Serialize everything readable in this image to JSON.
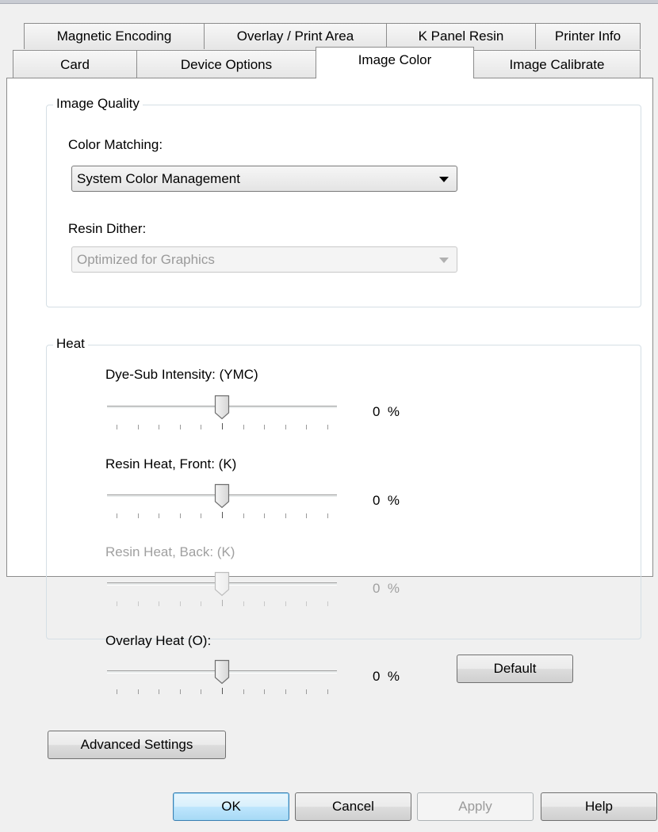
{
  "tabs_row1": [
    {
      "label": "Magnetic Encoding"
    },
    {
      "label": "Overlay / Print Area"
    },
    {
      "label": "K Panel Resin"
    },
    {
      "label": "Printer Info"
    }
  ],
  "tabs_row2": [
    {
      "label": "Card"
    },
    {
      "label": "Device Options"
    },
    {
      "label": "Image Color",
      "active": true
    },
    {
      "label": "Image Calibrate"
    }
  ],
  "image_quality": {
    "title": "Image Quality",
    "color_matching_label": "Color Matching:",
    "color_matching_value": "System Color Management",
    "resin_dither_label": "Resin Dither:",
    "resin_dither_value": "Optimized for Graphics"
  },
  "heat": {
    "title": "Heat",
    "sliders": [
      {
        "label": "Dye-Sub Intensity: (YMC)",
        "value": 0,
        "value_text": "0",
        "unit": "%",
        "enabled": true
      },
      {
        "label": "Resin Heat, Front: (K)",
        "value": 0,
        "value_text": "0",
        "unit": "%",
        "enabled": true
      },
      {
        "label": "Resin Heat, Back: (K)",
        "value": 0,
        "value_text": "0",
        "unit": "%",
        "enabled": false
      },
      {
        "label": "Overlay Heat  (O):",
        "value": 0,
        "value_text": "0",
        "unit": "%",
        "enabled": true
      }
    ],
    "slider_range": [
      -50,
      50
    ],
    "default_button": "Default"
  },
  "advanced_button": "Advanced Settings",
  "footer": {
    "ok": "OK",
    "cancel": "Cancel",
    "apply": "Apply",
    "help": "Help"
  },
  "colors": {
    "panel_bg": "#ffffff",
    "dialog_bg": "#f0f0f0",
    "group_border": "#d5dfe5",
    "primary_button": "#a7d9f5"
  }
}
